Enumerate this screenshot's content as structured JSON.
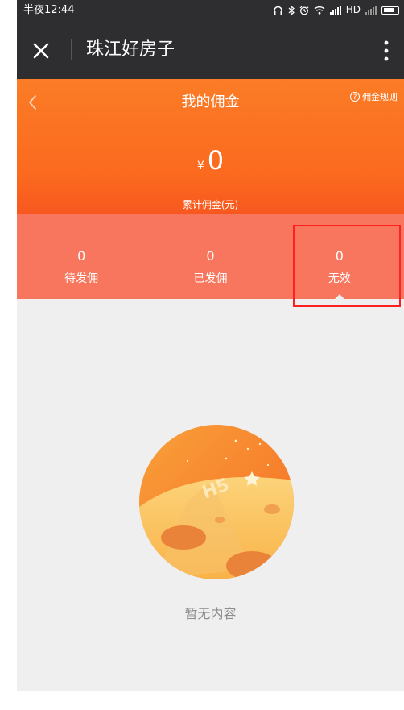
{
  "status_bar": {
    "time": "半夜12:44",
    "network_label": "HD"
  },
  "title_bar": {
    "title": "珠江好房子"
  },
  "header": {
    "title": "我的佣金",
    "rules_label": "佣金规则",
    "currency_symbol": "¥",
    "amount": "0",
    "amount_label": "累计佣金(元)"
  },
  "tabs": [
    {
      "count": "0",
      "label": "待发佣"
    },
    {
      "count": "0",
      "label": "已发佣"
    },
    {
      "count": "0",
      "label": "无效"
    }
  ],
  "selected_tab": "无效",
  "empty_state": {
    "text": "暂无内容"
  },
  "colors": {
    "title_bar_bg": "#2e2e30",
    "header_orange": "#fb6a1f",
    "tab_bar_bg": "#f8765d",
    "page_bg": "#efeff0",
    "highlight_red": "#ff2020"
  }
}
